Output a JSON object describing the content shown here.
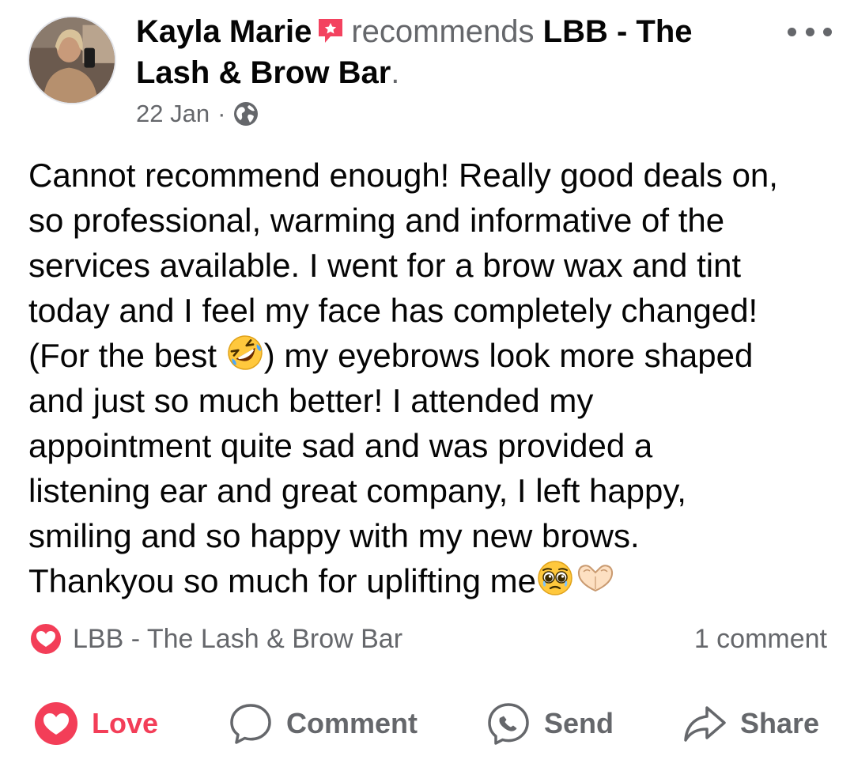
{
  "post": {
    "author": "Kayla Marie",
    "verb": "recommends",
    "page_name": "LBB - The Lash & Brow Bar",
    "period": ".",
    "date": "22 Jan",
    "separator": "·",
    "audience_icon": "globe-icon",
    "recommend_icon": "recommend-star-flag-icon",
    "text_parts": [
      "Cannot recommend enough! Really good deals on,\nso professional, warming and informative of the\nservices available. I went for a brow wax and tint\ntoday and I feel my face has completely changed!\n(For the best ",
      ") my eyebrows look more shaped\nand just so much better! I attended my\nappointment quite sad and was provided a\nlistening ear and great company, I left happy,\nsmiling and so happy with my new brows.\nThankyou so much for uplifting me"
    ],
    "emojis": [
      "rolling-on-floor-laughing-emoji",
      "pleading-face-emoji",
      "heart-hands-emoji"
    ]
  },
  "reactions": {
    "icon": "love-reaction-icon",
    "reactor": "LBB - The Lash & Brow Bar",
    "comment_count": "1 comment"
  },
  "actions": {
    "love": "Love",
    "comment": "Comment",
    "send": "Send",
    "share": "Share"
  },
  "colors": {
    "text": "#050505",
    "secondary": "#65676b",
    "love_red": "#f33e58",
    "recommend_red": "#f3425f"
  }
}
